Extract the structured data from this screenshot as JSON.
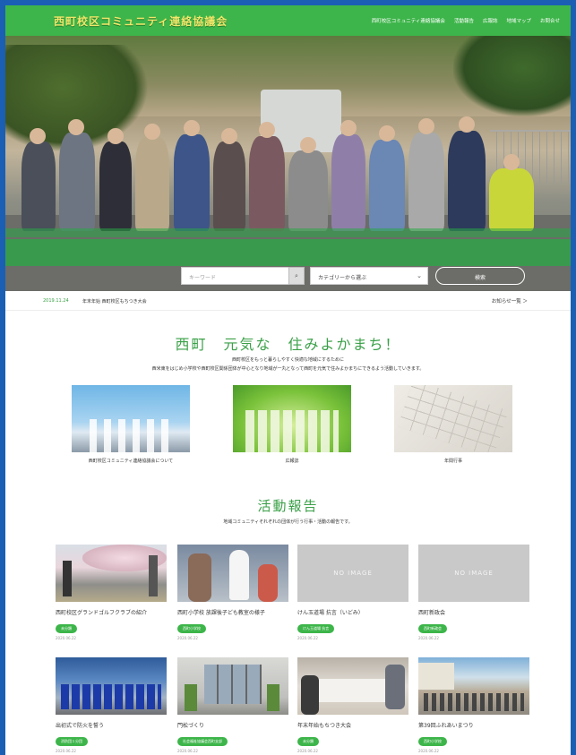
{
  "header": {
    "logo": "西町校区コミュニティ連絡協議会",
    "nav": [
      "西町校区コミュニティ連絡協議会",
      "活動報告",
      "広報誌",
      "地域マップ",
      "お問合せ"
    ]
  },
  "search": {
    "keyword_placeholder": "キーワード",
    "category_label": "カテゴリーから選ぶ",
    "search_button": "検索"
  },
  "news": {
    "date": "2019.11.24",
    "text": "年末年始 西町校区もちつき大会",
    "all_link": "お知らせ一覧 ＞"
  },
  "intro": {
    "title": "西町　元気な　住みよかまち！",
    "line1": "西町校区をもっと暮らしやすく快適な地域にするために",
    "line2": "西米東をはじめ小学校や西町校区関係団体が中心となり地域が一丸となって西町を元気で住みよかまちにできるよう活動していきます。"
  },
  "features": [
    {
      "label": "西町校区コミュニティ連絡協議会について"
    },
    {
      "label": "広報誌"
    },
    {
      "label": "年間行事"
    }
  ],
  "activity": {
    "title": "活動報告",
    "subtitle": "地域コミュニティそれぞれの団体が行う行事・活動の報告です。",
    "cards": [
      {
        "title": "西町校区グランドゴルフクラブの紹介",
        "badge": "未分類",
        "date": "2020.06.22",
        "image": "cherry-blossom-photo"
      },
      {
        "title": "西町小学校 放課後子ども教室の様子",
        "badge": "西町小学校",
        "date": "2020.06.22",
        "image": "robot-photo"
      },
      {
        "title": "けん玉道場 抗言（いどみ）",
        "badge": "けん玉道場 抗言",
        "date": "2020.06.22",
        "image": "NO IMAGE"
      },
      {
        "title": "西町新政会",
        "badge": "西町新政会",
        "date": "2020.06.22",
        "image": "NO IMAGE"
      },
      {
        "title": "出初式で防火を誓う",
        "badge": "消防団１分団",
        "date": "2020.06.22",
        "image": "firefighters-photo"
      },
      {
        "title": "門松づくり",
        "badge": "社会福祉協議会西町支部",
        "date": "2020.06.22",
        "image": "building-photo"
      },
      {
        "title": "年末年始もちつき大会",
        "badge": "未分類",
        "date": "2020.06.22",
        "image": "mochi-photo"
      },
      {
        "title": "第39回ふれあいまつり",
        "badge": "西町小学校",
        "date": "2020.06.22",
        "image": "festival-photo"
      }
    ]
  },
  "colors": {
    "brand_green": "#3db54a",
    "logo_yellow": "#f2e66a",
    "frame_blue": "#1a5fb4"
  }
}
